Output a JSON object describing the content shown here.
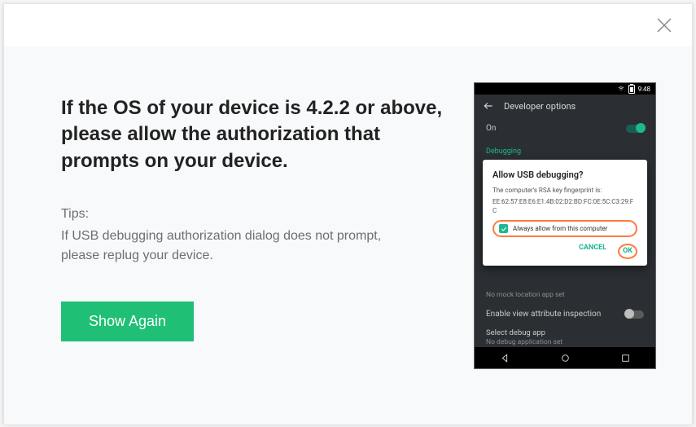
{
  "main": {
    "heading": "If the OS of your device is 4.2.2 or above, please allow the authorization that prompts on your device.",
    "tips_label": "Tips:",
    "tips_text": "If USB debugging authorization dialog does not prompt, please replug your device.",
    "show_again_label": "Show Again"
  },
  "phone": {
    "time": "9:48",
    "appbar_title": "Developer options",
    "toggle_on_label": "On",
    "section_debugging": "Debugging",
    "popup": {
      "title": "Allow USB debugging?",
      "fingerprint_label": "The computer's RSA key fingerprint is:",
      "fingerprint_value": "EE:62:57:E8:E6:E1:4B:02:D2:BD:FC:0E:5C:C3:29:FC",
      "always_label": "Always allow from this computer",
      "cancel": "CANCEL",
      "ok": "OK"
    },
    "row_mock": "No mock location app set",
    "row_view_attr": "Enable view attribute inspection",
    "row_select_debug": "Select debug app",
    "row_select_debug_sub": "No debug application set"
  }
}
